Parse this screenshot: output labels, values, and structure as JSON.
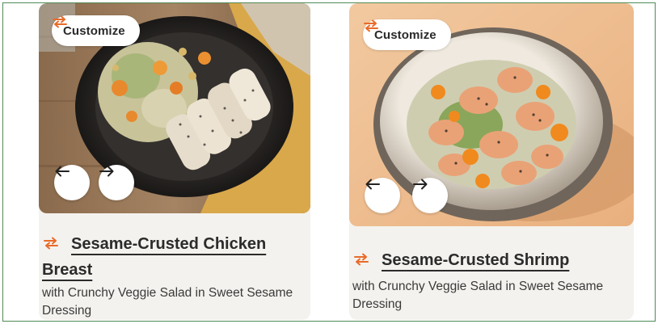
{
  "accent_color": "#e96b2a",
  "cards": [
    {
      "customize_label": "Customize",
      "customize_icon": "swap-arrows-icon",
      "prev_icon": "arrow-left-icon",
      "next_icon": "arrow-right-icon",
      "title": "Sesame-Crusted Chicken Breast",
      "subtitle": "with Crunchy Veggie Salad in Sweet Sesame Dressing"
    },
    {
      "customize_label": "Customize",
      "customize_icon": "swap-arrows-icon",
      "prev_icon": "arrow-left-icon",
      "next_icon": "arrow-right-icon",
      "title": "Sesame-Crusted Shrimp",
      "subtitle": "with Crunchy Veggie Salad in Sweet Sesame Dressing"
    }
  ]
}
